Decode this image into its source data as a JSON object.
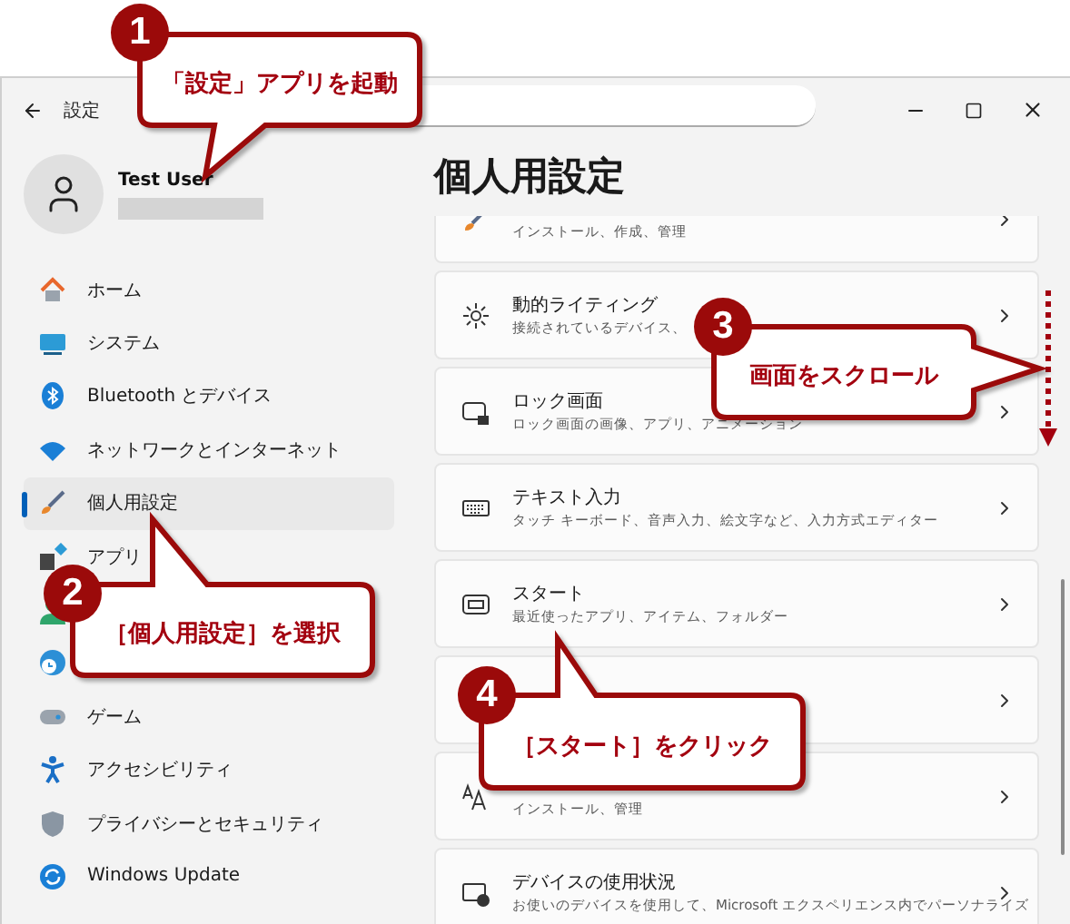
{
  "window": {
    "title": "設定"
  },
  "profile": {
    "name": "Test User"
  },
  "sidebar": {
    "items": [
      {
        "kind": "home",
        "label": "ホーム",
        "selected": false
      },
      {
        "kind": "system",
        "label": "システム",
        "selected": false
      },
      {
        "kind": "bluetooth",
        "label": "Bluetooth とデバイス",
        "selected": false
      },
      {
        "kind": "wifi",
        "label": "ネットワークとインターネット",
        "selected": false
      },
      {
        "kind": "brush",
        "label": "個人用設定",
        "selected": true
      },
      {
        "kind": "apps",
        "label": "アプリ",
        "selected": false
      },
      {
        "kind": "account",
        "selected": false
      },
      {
        "kind": "time",
        "selected": false
      },
      {
        "kind": "game",
        "label": "ゲーム",
        "selected": false
      },
      {
        "kind": "access",
        "label": "アクセシビリティ",
        "selected": false
      },
      {
        "kind": "shield",
        "label": "プライバシーとセキュリティ",
        "selected": false
      },
      {
        "kind": "update",
        "label": "Windows Update",
        "selected": false
      }
    ]
  },
  "page": {
    "title": "個人用設定",
    "cards": [
      {
        "kind": "brush",
        "subtitle": "インストール、作成、管理"
      },
      {
        "kind": "light",
        "title": "動的ライティング",
        "subtitle": "接続されているデバイス、"
      },
      {
        "kind": "lock",
        "title": "ロック画面",
        "subtitle": "ロック画面の画像、アプリ、アニメーション"
      },
      {
        "kind": "keyboard",
        "title": "テキスト入力",
        "subtitle": "タッチ キーボード、音声入力、絵文字など、入力方式エディター"
      },
      {
        "kind": "start",
        "title": "スタート",
        "subtitle": "最近使ったアプリ、アイテム、フォルダー"
      },
      {
        "kind": "none"
      },
      {
        "kind": "font",
        "subtitle": "インストール、管理"
      },
      {
        "kind": "device",
        "title": "デバイスの使用状況",
        "subtitle": "お使いのデバイスを使用して、Microsoft エクスペリエンス内でパーソナライズ"
      }
    ]
  },
  "callouts": [
    {
      "number": "1",
      "text": "「設定」アプリを起動"
    },
    {
      "number": "2",
      "text": "［個人用設定］を選択"
    },
    {
      "number": "3",
      "text": "画面をスクロール"
    },
    {
      "number": "4",
      "text": "［スタート］をクリック"
    }
  ]
}
